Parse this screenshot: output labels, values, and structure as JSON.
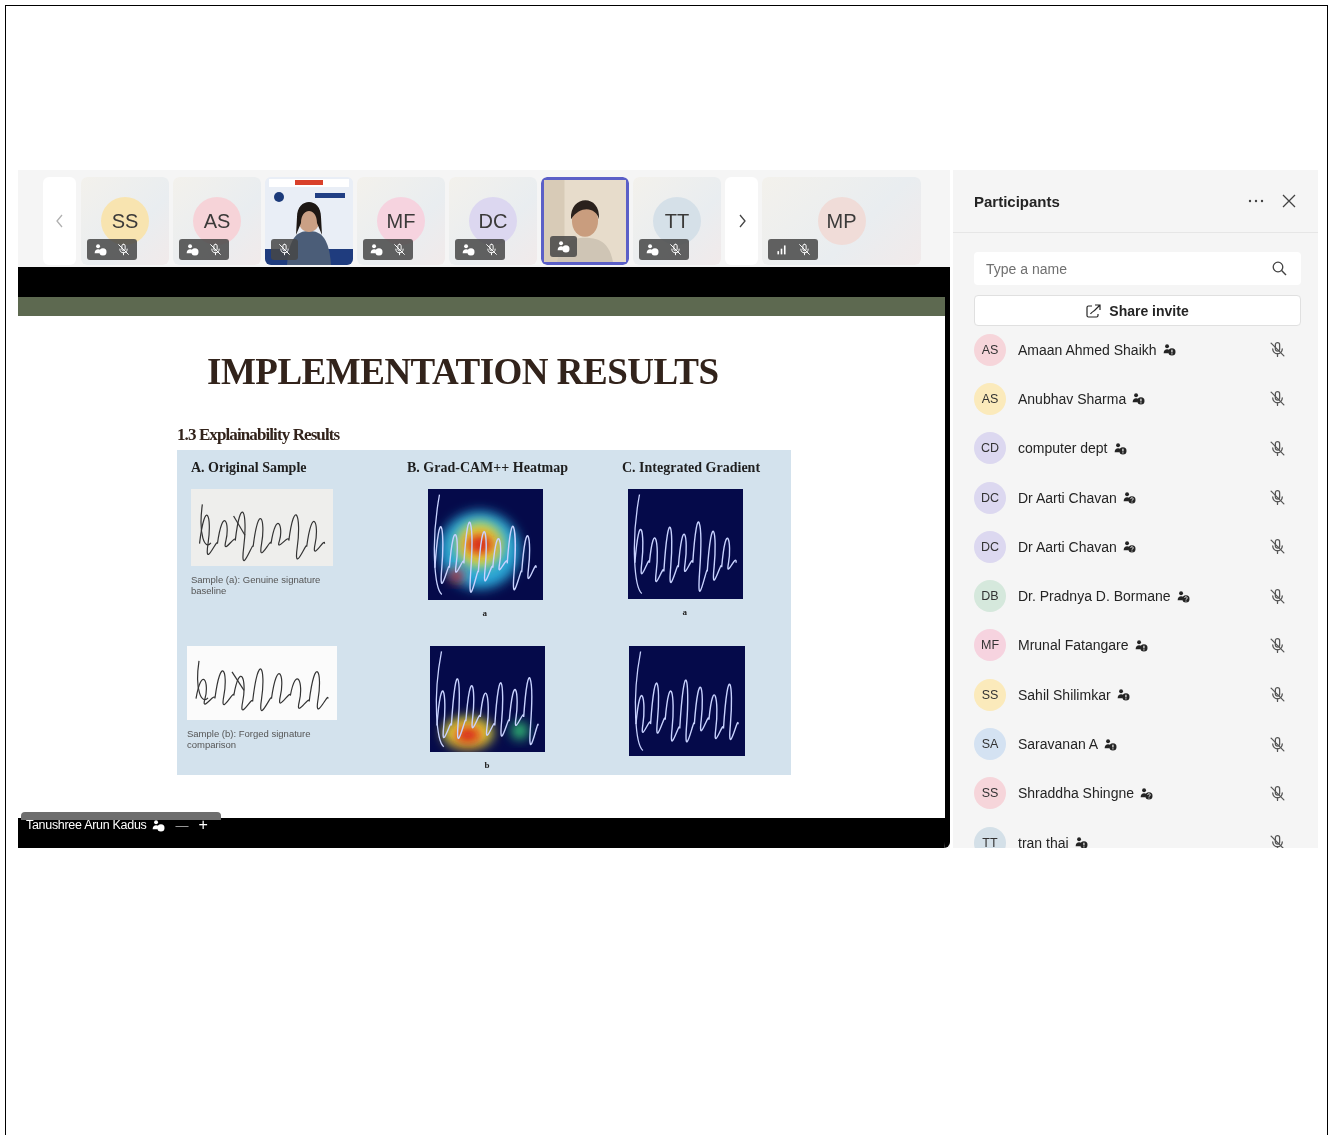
{
  "tiles": [
    {
      "kind": "avatar",
      "initials": "SS",
      "color": "#f8e4b0",
      "external": true,
      "muted": true,
      "selected": false
    },
    {
      "kind": "avatar",
      "initials": "AS",
      "color": "#f6d3d8",
      "external": true,
      "muted": true,
      "selected": false
    },
    {
      "kind": "video",
      "muted": true,
      "selected": false
    },
    {
      "kind": "avatar",
      "initials": "MF",
      "color": "#f6d3df",
      "external": true,
      "muted": true,
      "selected": false
    },
    {
      "kind": "avatar",
      "initials": "DC",
      "color": "#dcd7f0",
      "unverified": true,
      "muted": true,
      "selected": false
    },
    {
      "kind": "video",
      "unverified": true,
      "muted": false,
      "selected": true
    },
    {
      "kind": "avatar",
      "initials": "TT",
      "color": "#d5e0e8",
      "external": true,
      "muted": true,
      "selected": false
    },
    {
      "kind": "avatar",
      "initials": "MP",
      "color": "#f0dcd8",
      "weak_signal": true,
      "muted": true,
      "selected": false
    }
  ],
  "slide": {
    "title": "IMPLEMENTATION RESULTS",
    "subtitle": "1.3 Explainability Results",
    "columns": [
      {
        "heading": "A. Original Sample",
        "items": [
          {
            "kind": "picture",
            "caption": "Sample (a): Genuine signature baseline"
          },
          {
            "kind": "picture",
            "caption": "Sample (b): Forged signature comparison"
          }
        ]
      },
      {
        "heading": "B. Grad-CAM++ Heatmap",
        "items": [
          {
            "kind": "picture",
            "caption": "a"
          },
          {
            "kind": "picture",
            "caption": "b"
          }
        ]
      },
      {
        "heading": "C. Integrated Gradient",
        "items": [
          {
            "kind": "picture",
            "caption": "a"
          },
          {
            "kind": "picture"
          }
        ]
      }
    ]
  },
  "presenter": {
    "name": "Tanushree Arun Kadus",
    "unverified": true,
    "controls": [
      {
        "kind": "minimize",
        "label": "—"
      },
      {
        "kind": "pin",
        "label": "+"
      }
    ]
  },
  "panel": {
    "title": "Participants",
    "search": {
      "placeholder": "Type a name"
    },
    "share_button": "Share invite",
    "participants": [
      {
        "initials": "AS",
        "name": "Amaan Ahmed Shaikh",
        "color": "#f6d5da",
        "external": true,
        "muted": true
      },
      {
        "initials": "AS",
        "name": "Anubhav Sharma",
        "color": "#fbeabb",
        "external": true,
        "muted": true
      },
      {
        "initials": "CD",
        "name": "computer dept",
        "color": "#dcd8f0",
        "external": true,
        "muted": true
      },
      {
        "initials": "DC",
        "name": "Dr Aarti Chavan",
        "color": "#dcd8f0",
        "unverified": true,
        "muted": true
      },
      {
        "initials": "DC",
        "name": "Dr Aarti Chavan",
        "color": "#dcd8f0",
        "unverified": true,
        "muted": true
      },
      {
        "initials": "DB",
        "name": "Dr. Pradnya D. Bormane",
        "color": "#d5e8dc",
        "unverified": true,
        "muted": true
      },
      {
        "initials": "MF",
        "name": "Mrunal Fatangare",
        "color": "#f6d3df",
        "external": true,
        "muted": true
      },
      {
        "initials": "SS",
        "name": "Sahil Shilimkar",
        "color": "#fbeabb",
        "external": true,
        "muted": true
      },
      {
        "initials": "SA",
        "name": "Saravanan A",
        "color": "#d4e2f2",
        "external": true,
        "muted": true
      },
      {
        "initials": "SS",
        "name": "Shraddha Shingne",
        "color": "#f6d5da",
        "unverified": true,
        "muted": true
      },
      {
        "initials": "TT",
        "name": "tran thai",
        "color": "#d4e0e8",
        "external": true,
        "muted": true
      }
    ]
  }
}
